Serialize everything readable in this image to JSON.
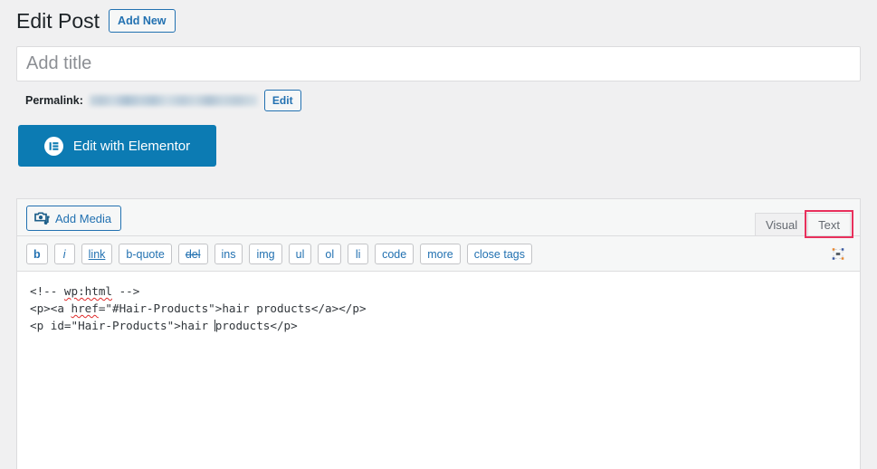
{
  "header": {
    "title": "Edit Post",
    "add_new_label": "Add New"
  },
  "title_field": {
    "placeholder": "Add title",
    "value": ""
  },
  "permalink": {
    "label": "Permalink:",
    "url_redacted": true,
    "edit_label": "Edit"
  },
  "elementor": {
    "label": "Edit with Elementor",
    "icon": "elementor-logo-icon",
    "color": "#0c7bb3"
  },
  "editor": {
    "add_media_label": "Add Media",
    "add_media_icon": "media-add-icon",
    "fullscreen_icon": "distraction-free-writing-icon",
    "tabs": [
      {
        "label": "Visual",
        "active": false,
        "annotated": false
      },
      {
        "label": "Text",
        "active": true,
        "annotated": true
      }
    ],
    "annotation_color": "#e8305c",
    "quicktags": [
      {
        "label": "b",
        "style": "bold"
      },
      {
        "label": "i",
        "style": "italic"
      },
      {
        "label": "link",
        "style": "underline"
      },
      {
        "label": "b-quote",
        "style": "normal"
      },
      {
        "label": "del",
        "style": "strikethrough"
      },
      {
        "label": "ins",
        "style": "normal"
      },
      {
        "label": "img",
        "style": "normal"
      },
      {
        "label": "ul",
        "style": "normal"
      },
      {
        "label": "ol",
        "style": "normal"
      },
      {
        "label": "li",
        "style": "normal"
      },
      {
        "label": "code",
        "style": "normal"
      },
      {
        "label": "more",
        "style": "normal"
      },
      {
        "label": "close tags",
        "style": "normal"
      }
    ],
    "content_lines": [
      "<!-- wp:html -->",
      "<p><a href=\"#Hair-Products\">hair products</a></p>",
      "<p id=\"Hair-Products\">hair products</p>"
    ],
    "misspelled_words": [
      "wp:html",
      "href"
    ],
    "caret_line": 3,
    "caret_after_text": "<p id=\"Hair-Products\">hair "
  }
}
